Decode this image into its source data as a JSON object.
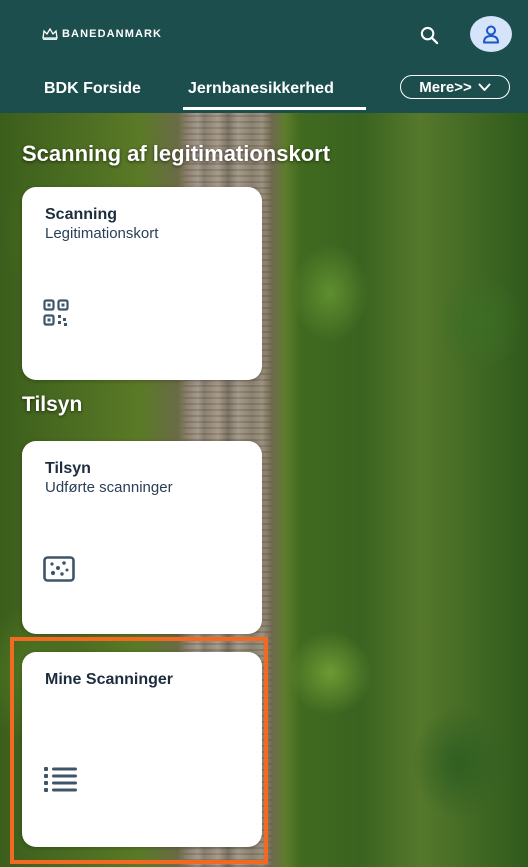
{
  "header": {
    "logo_text": "BANEDANMARK",
    "logo_icon": "crown-icon",
    "search_icon": "search-icon",
    "avatar_icon": "user-icon",
    "tabs": [
      {
        "label": "BDK Forside"
      },
      {
        "label": "Jernbanesikkerhed",
        "selected": true
      }
    ],
    "more_label": "Mere>>"
  },
  "sections": [
    {
      "title": "Scanning af legitimationskort",
      "cards": [
        {
          "title": "Scanning",
          "subtitle": "Legitimationskort",
          "icon": "qr-code-icon"
        }
      ]
    },
    {
      "title": "Tilsyn",
      "cards": [
        {
          "title": "Tilsyn",
          "subtitle": "Udførte scanninger",
          "icon": "scatter-chart-icon"
        },
        {
          "title": "Mine Scanninger",
          "subtitle": "",
          "icon": "bulleted-list-icon",
          "highlighted": true
        }
      ]
    }
  ],
  "colors": {
    "header_bg": "#1c4e4d",
    "avatar_bg": "#d5e4fb",
    "highlight_border": "#f26a21",
    "icon_color": "#3e5569"
  }
}
